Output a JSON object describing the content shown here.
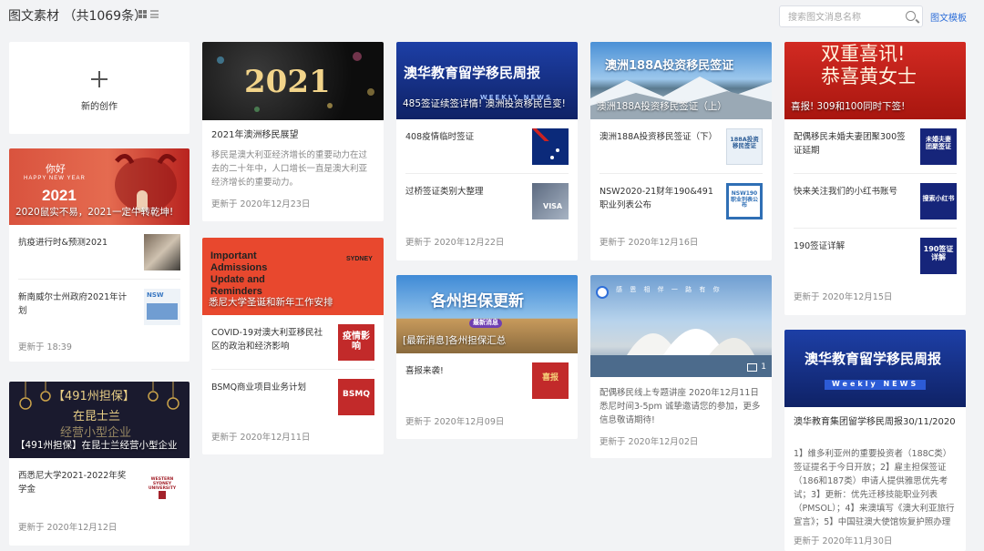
{
  "header": {
    "title": "图文素材 （共1069条）",
    "search_placeholder": "搜索图文消息名称",
    "template_link": "图文模板"
  },
  "new_card": {
    "label": "新的创作"
  },
  "cards": {
    "c1": {
      "cover_title": "2020鼠实不易，2021一定牛转乾坤!",
      "cover_art": {
        "greeting": "你好",
        "line": "HAPPY NEW YEAR",
        "year": "2021"
      },
      "items": [
        "抗疫进行时&预测2021",
        "新南威尔士州政府2021年计划"
      ],
      "thumb_text": [
        "",
        "NSW"
      ],
      "updated": "更新于 18:39"
    },
    "c2": {
      "cover_title": "【491州担保】在昆士兰经营小型企业",
      "cover_art": {
        "big": "【491州担保】",
        "line2": "在昆士兰",
        "line3": "经营小型企业"
      },
      "items": [
        "西悉尼大学2021-2022年奖学金"
      ],
      "thumb_text": [
        "WESTERN SYDNEY UNIVERSITY"
      ],
      "updated": "更新于 2020年12月12日"
    },
    "c3": {
      "cover_art": {
        "year": "2021"
      },
      "title": "2021年澳洲移民展望",
      "desc": "移民是澳大利亚经济增长的重要动力在过去的二十年中，人口增长一直是澳大利亚经济增长的重要动力。",
      "updated": "更新于 2020年12月23日"
    },
    "c4": {
      "cover_title": "悉尼大学圣诞和新年工作安排",
      "cover_art": {
        "en": "Important Admissions Update and Reminders",
        "logo": "SYDNEY"
      },
      "items": [
        "COVID-19对澳大利亚移民社区的政治和经济影响",
        "BSMQ商业项目业务计划"
      ],
      "thumb_text": [
        "疫情影响",
        "BSMQ"
      ],
      "updated": "更新于 2020年12月11日"
    },
    "c5": {
      "cover_title": "485签证续签详情! 澳洲投资移民巨变!",
      "cover_art": {
        "banner": "澳华教育留学移民周报",
        "sub": "WEEKLY NEWS"
      },
      "items": [
        "408疫情临时签证",
        "过桥签证类别大整理"
      ],
      "thumb_text": [
        "",
        "VISA"
      ],
      "updated": "更新于 2020年12月22日"
    },
    "c6": {
      "cover_title": "[最新消息]各州担保汇总",
      "cover_art": {
        "banner": "各州担保更新",
        "tag": "最新消息"
      },
      "items": [
        "喜报来袭!"
      ],
      "thumb_text": [
        "喜报"
      ],
      "updated": "更新于 2020年12月09日"
    },
    "c7": {
      "cover_title": "澳洲188A投资移民签证（上）",
      "cover_art": {
        "banner": "澳洲188A投资移民签证"
      },
      "items": [
        "澳洲188A投资移民签证（下）",
        "NSW2020-21财年190&491职业列表公布"
      ],
      "thumb_text": [
        "188A投资移民签证",
        "NSW190职业列表公布"
      ],
      "updated": "更新于 2020年12月16日"
    },
    "c8": {
      "cover_art": {
        "slogan": "感 恩 相 伴 一 路 有 你",
        "count": "1"
      },
      "desc": "配偶移民线上专题讲座 2020年12月11日 悉尼时间3-5pm 诚挚邀请您的参加，更多信息敬请期待!",
      "updated": "更新于 2020年12月02日"
    },
    "c9": {
      "cover_title": "喜报! 309和100同时下签!",
      "cover_art": {
        "line1": "双重喜讯!",
        "line2": "恭喜黄女士"
      },
      "items": [
        "配偶移民未婚夫妻团聚300签证延期",
        "快来关注我们的小红书账号",
        "190签证详解"
      ],
      "thumb_text": [
        "未婚夫妻团聚签证",
        "搜索小红书",
        "190签证详解"
      ],
      "updated": "更新于 2020年12月15日"
    },
    "c10": {
      "cover_art": {
        "banner": "澳华教育留学移民周报",
        "sub": "Weekly NEWS"
      },
      "title": "澳华教育集团留学移民周报30/11/2020",
      "desc": "1】维多利亚州的重要投资者（188C类）签证提名于今日开放；2】雇主担保签证（186和187类）申请人提供雅思优先考试；3】更新：优先迁移技能职业列表（PMSOL）；4】来澳填写《澳大利亚旅行宣言》；5】中国驻澳大使馆恢复护照办理",
      "updated": "更新于 2020年11月30日"
    }
  },
  "colors": {
    "accent": "#2f6fd9",
    "background": "#f2f3f5",
    "card": "#ffffff"
  }
}
